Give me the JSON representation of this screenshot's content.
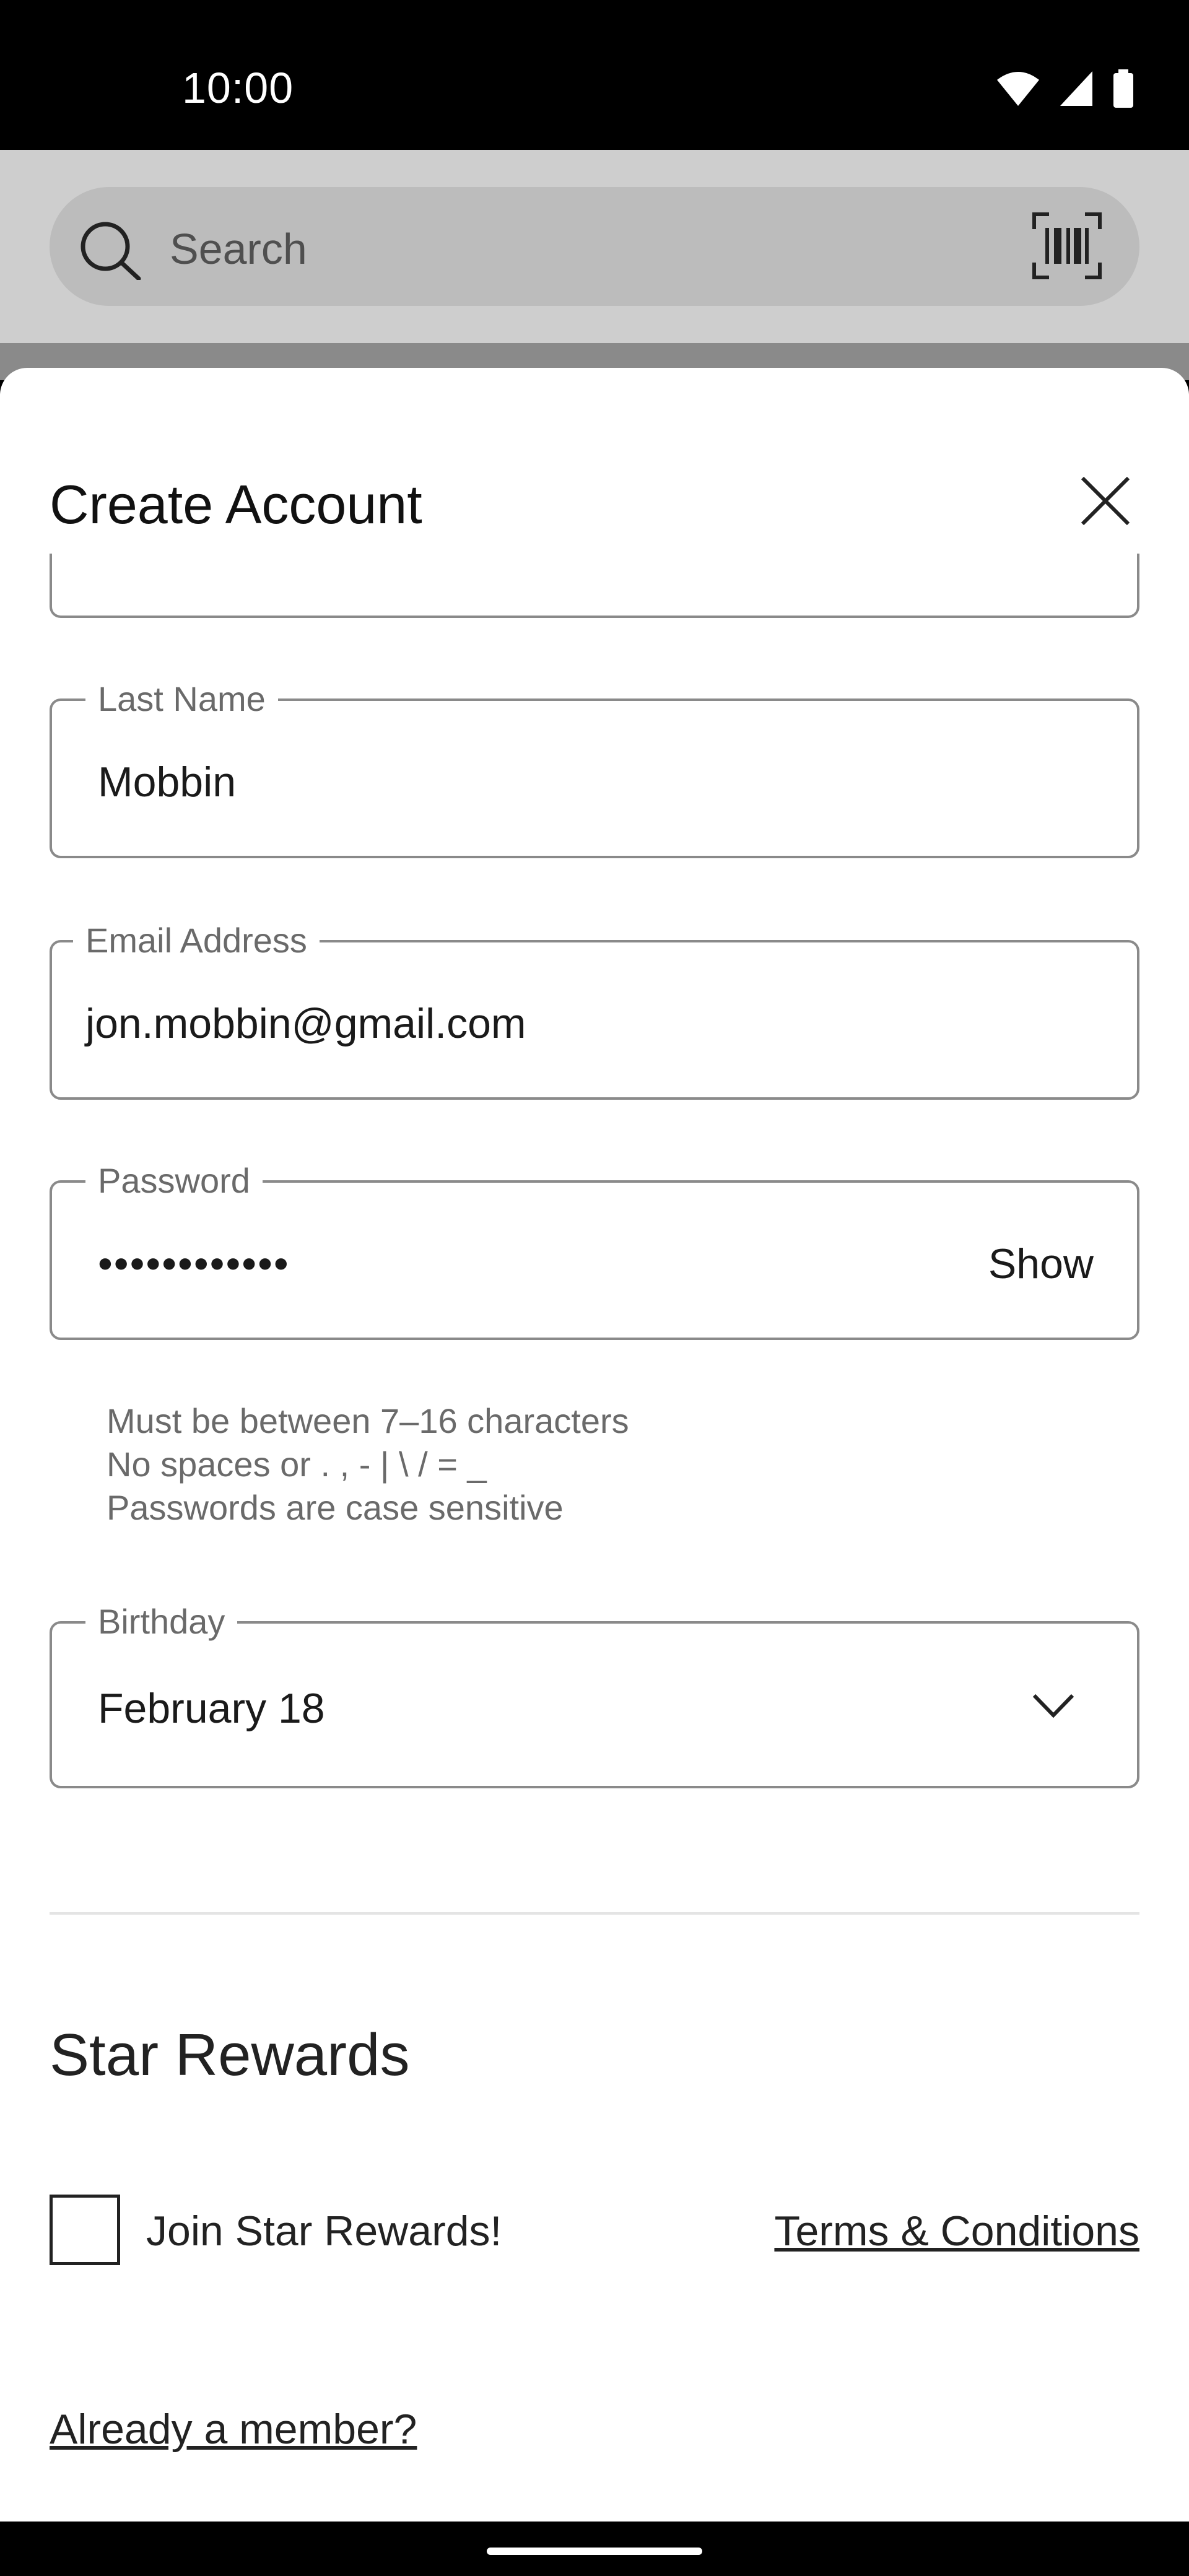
{
  "status_bar": {
    "time": "10:00"
  },
  "search": {
    "placeholder": "Search"
  },
  "sheet": {
    "title": "Create Account"
  },
  "fields": {
    "last_name": {
      "label": "Last Name",
      "value": "Mobbin"
    },
    "email": {
      "label": "Email Address",
      "value": "jon.mobbin@gmail.com"
    },
    "password": {
      "label": "Password",
      "value": "••••••••••••",
      "show_label": "Show"
    },
    "birthday": {
      "label": "Birthday",
      "value": "February 18"
    }
  },
  "password_help": {
    "line1": "Must be between 7–16 characters",
    "line2": "No spaces or . , - | \\ / = _",
    "line3": "Passwords are case sensitive"
  },
  "rewards": {
    "title": "Star Rewards",
    "checkbox_label": "Join Star Rewards!",
    "terms_link": "Terms & Conditions"
  },
  "member_link": "Already a member?",
  "icons": {
    "search": "search-icon",
    "barcode": "barcode-icon",
    "close": "close-icon",
    "chevron": "chevron-down-icon",
    "wifi": "wifi-icon",
    "signal": "signal-icon",
    "battery": "battery-icon"
  }
}
